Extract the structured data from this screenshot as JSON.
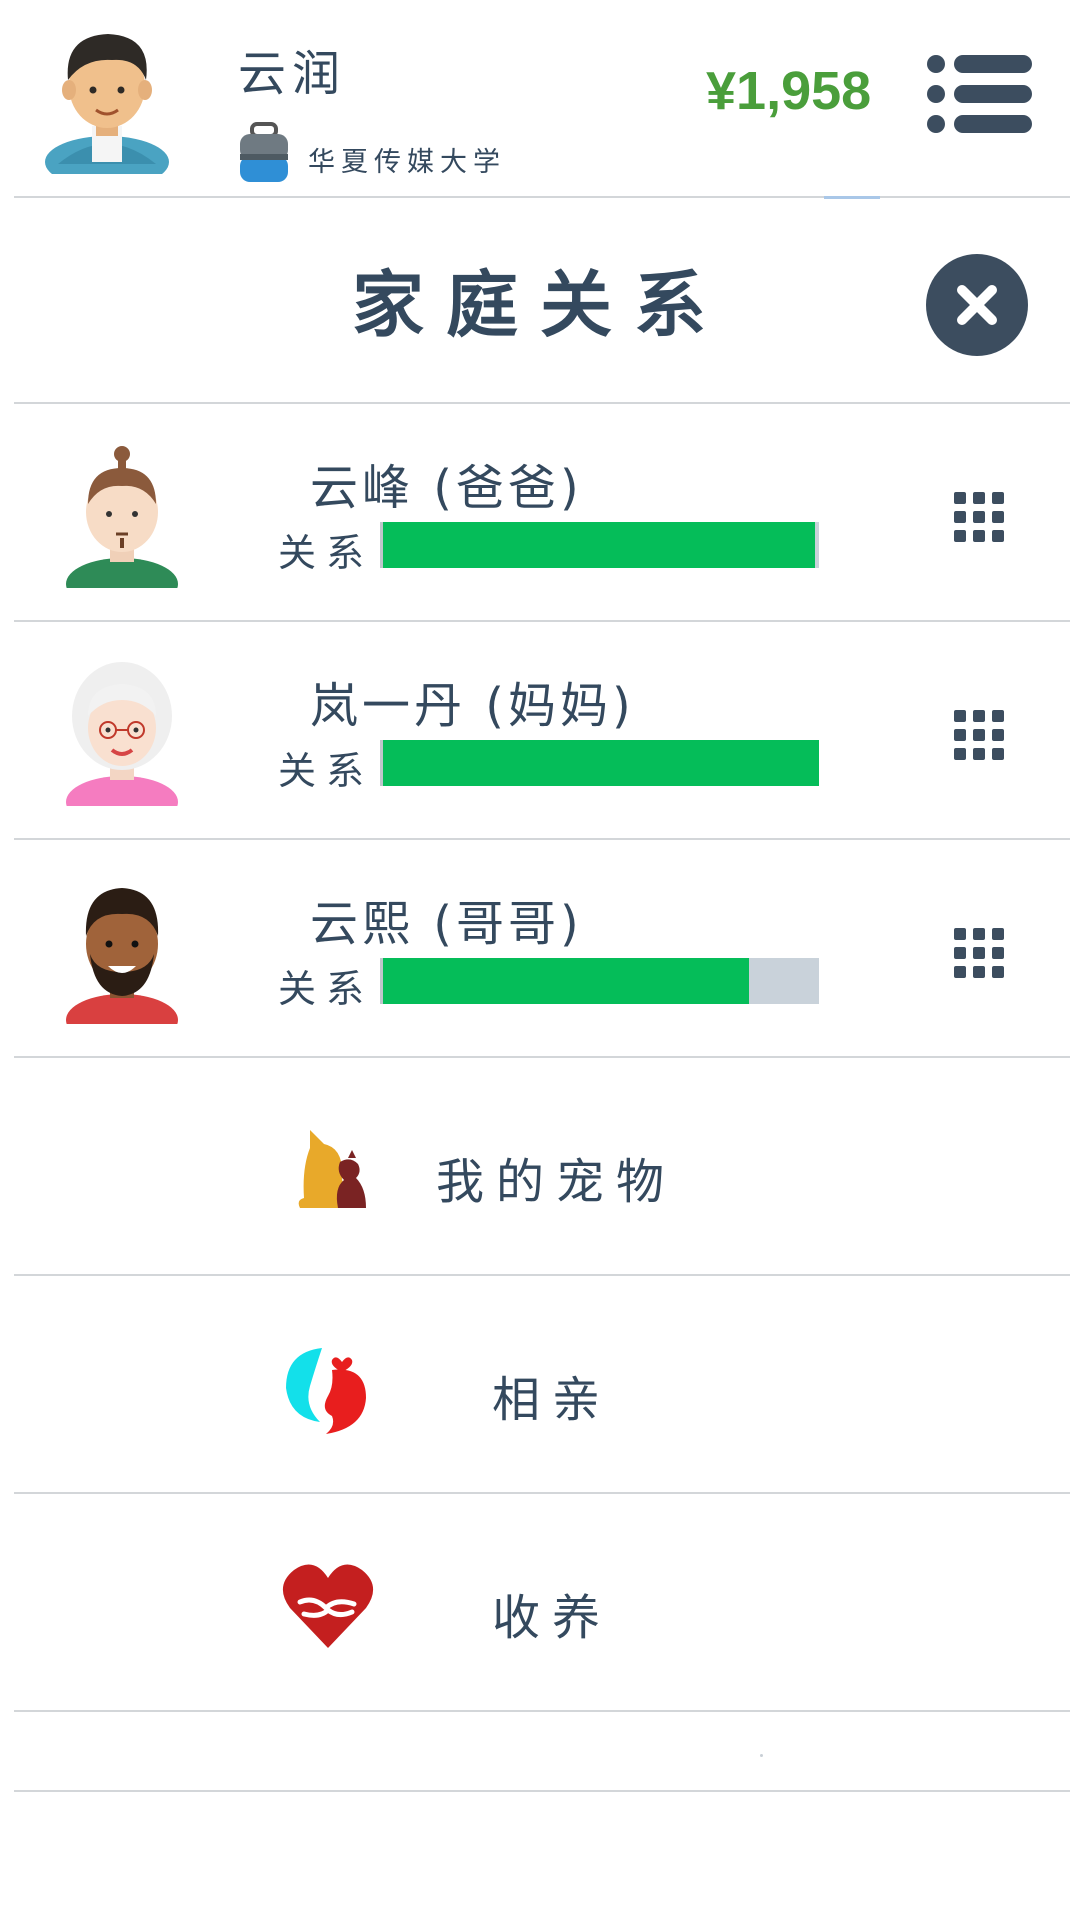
{
  "header": {
    "player_name": "云润",
    "school": "华夏传媒大学",
    "money": "¥1,958"
  },
  "section": {
    "title": "家庭关系"
  },
  "family": [
    {
      "name": "云峰 (爸爸)",
      "relation_label": "关系",
      "relation_level": 0.99,
      "avatar": "father-avatar"
    },
    {
      "name": "岚一丹 (妈妈)",
      "relation_label": "关系",
      "relation_level": 1.0,
      "avatar": "mother-avatar"
    },
    {
      "name": "云熙 (哥哥)",
      "relation_label": "关系",
      "relation_level": 0.84,
      "avatar": "brother-avatar"
    }
  ],
  "menu": [
    {
      "label": "我的宠物",
      "icon": "pet-icon"
    },
    {
      "label": "相亲",
      "icon": "dating-icon"
    },
    {
      "label": "收养",
      "icon": "adoption-heart-icon"
    }
  ],
  "colors": {
    "text": "#34495e",
    "money": "#4a9e3b",
    "bar_fill": "#05bd59",
    "bar_track": "#c9d2da",
    "close_button": "#3c4d5f"
  }
}
